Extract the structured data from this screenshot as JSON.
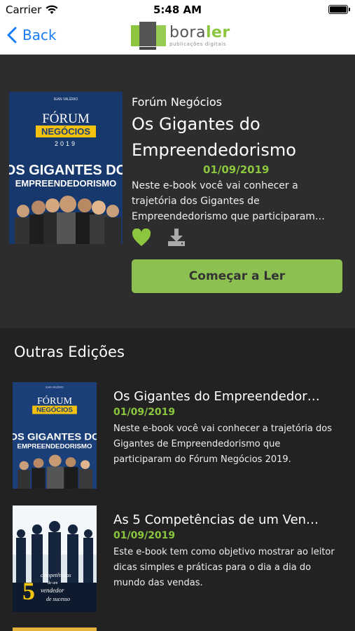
{
  "status": {
    "carrier": "Carrier",
    "time": "5:48 AM"
  },
  "nav": {
    "back_label": "Back",
    "logo_brand_a": "bora",
    "logo_brand_b": "ler",
    "logo_sub": "publicações digitais"
  },
  "hero": {
    "publisher": "Forúm Negócios",
    "title": "Os Gigantes do Empreendedorismo",
    "date": "01/09/2019",
    "description": "Neste e-book você vai conhecer a trajetória dos Gigantes de Empreendedorismo que participaram…",
    "read_button": "Começar a Ler",
    "cover": {
      "author": "IEAN VALÉRIO",
      "line1": "FÓRUM",
      "line2": "NEGÓCIOS",
      "year": "2019",
      "title1": "OS GIGANTES DO",
      "title2": "EMPREENDEDORISMO"
    }
  },
  "others": {
    "section_title": "Outras Edições",
    "items": [
      {
        "title": "Os Gigantes do Empreendedor…",
        "date": "01/09/2019",
        "description": "Neste e-book você vai conhecer a trajetória dos Gigantes de Empreendedorismo que participaram do Fórum Negócios 2019."
      },
      {
        "title": "As 5 Competências de um Ven…",
        "date": "01/09/2019",
        "description": "Este e-book tem como objetivo mostrar ao leitor dicas simples e práticas para o dia a dia do mundo das vendas.",
        "cover": {
          "big": "5",
          "line1": "competências",
          "line2": "de um",
          "line3": "vendedor",
          "line4": "de sucesso"
        }
      }
    ]
  },
  "colors": {
    "accent": "#8cc63f",
    "button": "#8cc152",
    "ios_blue": "#1a7cf5",
    "cover_blue": "#1b3f78"
  }
}
